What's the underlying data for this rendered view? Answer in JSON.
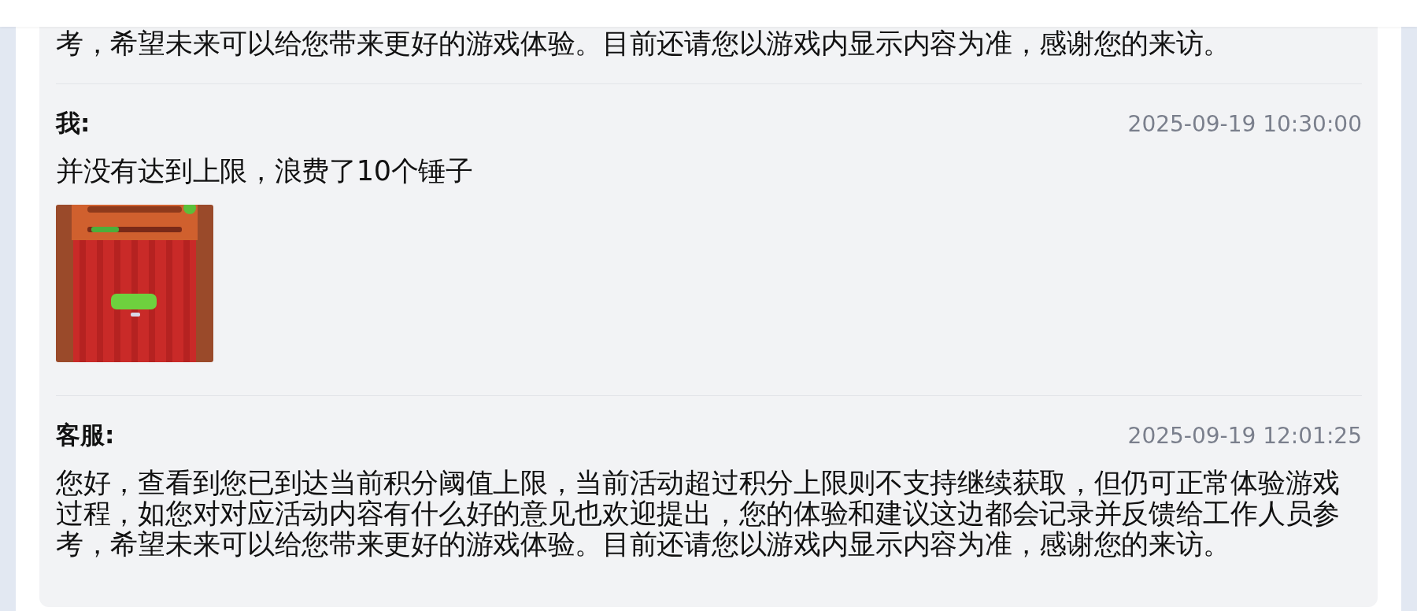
{
  "messages": [
    {
      "body": "考，希望未来可以给您带来更好的游戏体验。目前还请您以游戏内显示内容为准，感谢您的来访。"
    },
    {
      "sender": "我:",
      "time": "2025-09-19 10:30:00",
      "body": "并没有达到上限，浪费了10个锤子"
    },
    {
      "sender": "客服:",
      "time": "2025-09-19 12:01:25",
      "body": "您好，查看到您已到达当前积分阈值上限，当前活动超过积分上限则不支持继续获取，但仍可正常体验游戏过程，如您对对应活动内容有什么好的意见也欢迎提出，您的体验和建议这边都会记录并反馈给工作人员参考，希望未来可以给您带来更好的游戏体验。目前还请您以游戏内显示内容为准，感谢您的来访。"
    }
  ]
}
